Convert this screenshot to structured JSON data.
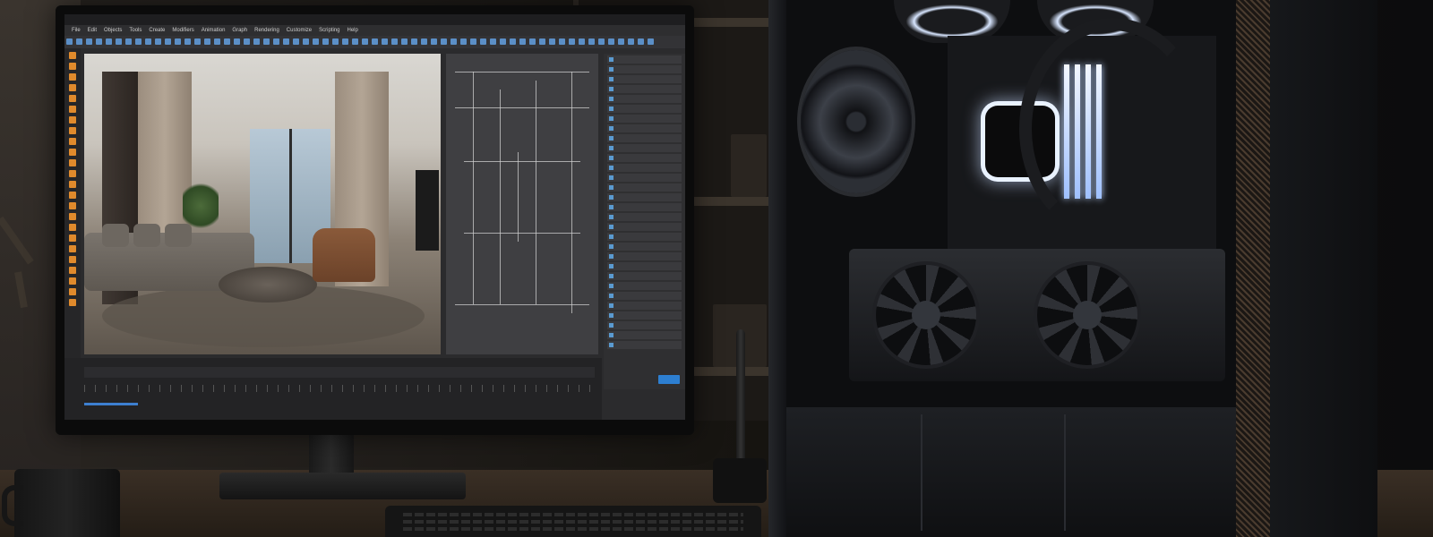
{
  "scene": {
    "monitor": {
      "app": {
        "menubar_items": [
          "File",
          "Edit",
          "Objects",
          "Tools",
          "Create",
          "Modifiers",
          "Animation",
          "Graph",
          "Rendering",
          "Customize",
          "Scripting",
          "Help"
        ],
        "panel_button_label": ""
      }
    }
  },
  "colors": {
    "accent": "#2d7fd1",
    "tool_icons": "#e08a2c",
    "led_glow": "#e9f2ff"
  }
}
